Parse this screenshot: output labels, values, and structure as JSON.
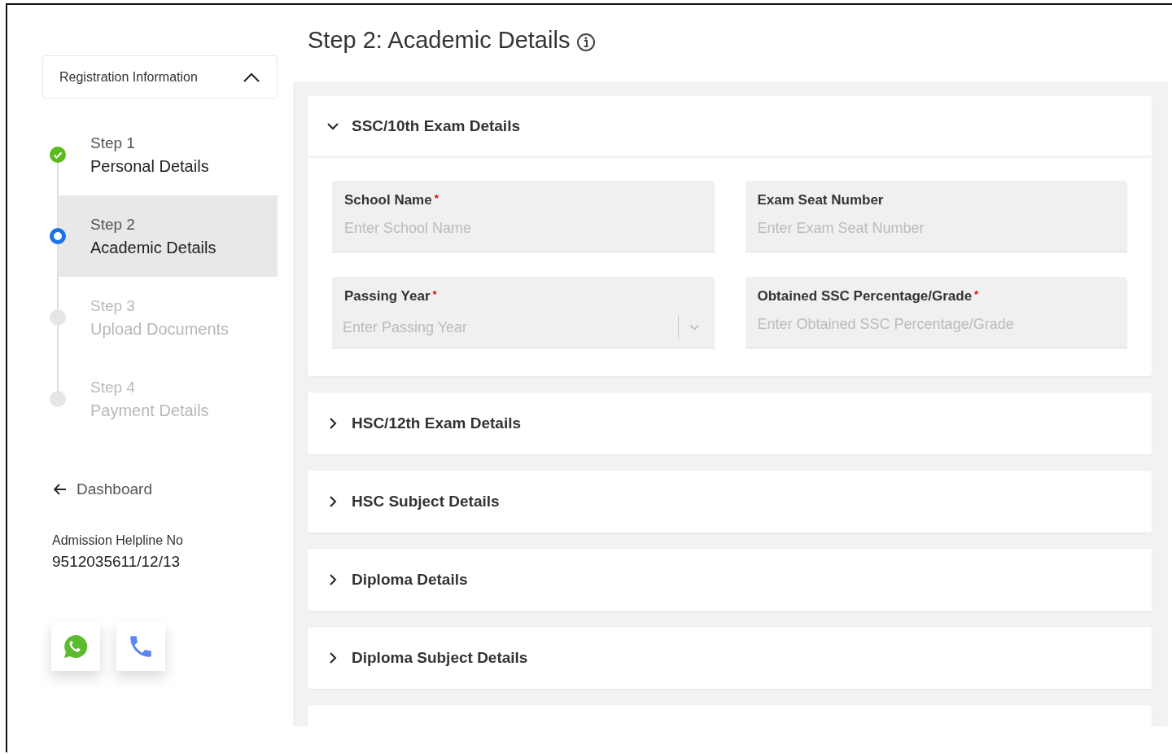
{
  "sidebar": {
    "header": {
      "title": "Registration Information",
      "expanded": true
    },
    "steps": [
      {
        "step": "Step 1",
        "name": "Personal Details",
        "completed": true,
        "selected": false,
        "disabled": false
      },
      {
        "step": "Step 2",
        "name": "Academic Details",
        "completed": false,
        "selected": true,
        "disabled": false
      },
      {
        "step": "Step 3",
        "name": "Upload Documents",
        "completed": false,
        "selected": false,
        "disabled": true
      },
      {
        "step": "Step 4",
        "name": "Payment Details",
        "completed": false,
        "selected": false,
        "disabled": true
      }
    ],
    "back_link": "Dashboard",
    "helpline": {
      "label": "Admission Helpline No",
      "number": "9512035611/12/13"
    },
    "contact_buttons": [
      {
        "kind": "whatsapp"
      },
      {
        "kind": "phone"
      }
    ]
  },
  "page_title": "Step 2: Academic Details",
  "sections": [
    {
      "title": "SSC/10th Exam Details",
      "expanded": true,
      "fields": [
        {
          "label": "School Name",
          "required_mark": "*",
          "placeholder": "Enter School Name",
          "kind": "text"
        },
        {
          "label": "Exam Seat Number",
          "placeholder": "Enter Exam Seat Number",
          "kind": "text"
        },
        {
          "label": "Passing Year",
          "required_mark": "*",
          "placeholder": "Enter Passing Year",
          "kind": "select"
        },
        {
          "label": "Obtained SSC Percentage/Grade",
          "required_mark": "*",
          "placeholder": "Enter Obtained SSC Percentage/Grade",
          "kind": "text"
        }
      ]
    },
    {
      "title": "HSC/12th Exam Details",
      "expanded": false
    },
    {
      "title": "HSC Subject Details",
      "expanded": false
    },
    {
      "title": "Diploma Details",
      "expanded": false
    },
    {
      "title": "Diploma Subject Details",
      "expanded": false
    }
  ]
}
